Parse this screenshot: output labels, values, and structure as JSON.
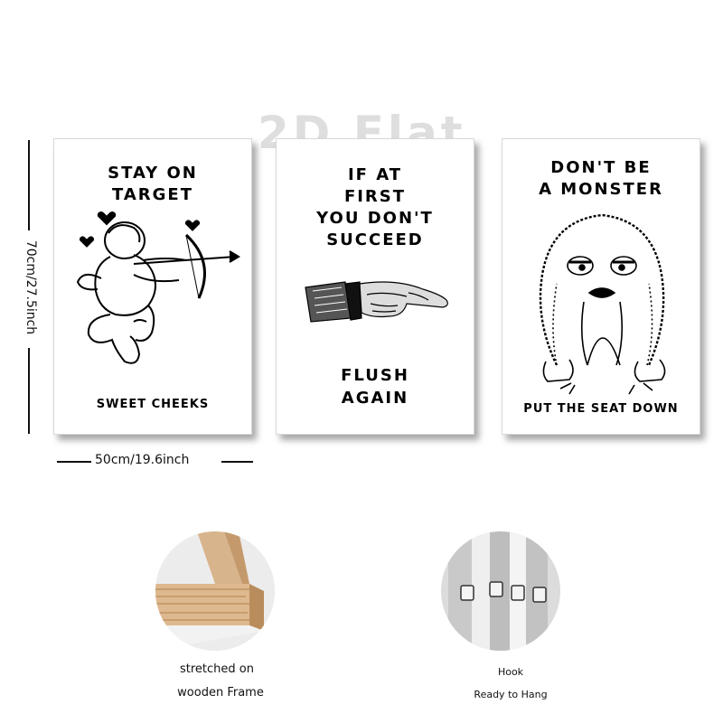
{
  "watermark": "2D Flat",
  "dimensions": {
    "height_label": "70cm/27.5inch",
    "width_label": "50cm/19.6inch"
  },
  "posters": [
    {
      "title_lines": [
        "STAY ON",
        "TARGET"
      ],
      "subtitle": "SWEET CHEEKS",
      "art": "cupid-icon"
    },
    {
      "title_lines": [
        "IF AT",
        "FIRST",
        "YOU DON'T",
        "SUCCEED"
      ],
      "subtitle_lines": [
        "FLUSH",
        "AGAIN"
      ],
      "art": "pointing-hand-icon"
    },
    {
      "title_lines": [
        "DON'T BE",
        "A MONSTER"
      ],
      "subtitle": "PUT THE SEAT DOWN",
      "art": "monster-icon"
    }
  ],
  "features": [
    {
      "caption_lines": [
        "stretched on",
        "wooden Frame"
      ],
      "icon": "wooden-frame-icon"
    },
    {
      "caption_lines": [
        "Hook",
        "Ready to Hang"
      ],
      "icon": "hook-icon"
    }
  ]
}
